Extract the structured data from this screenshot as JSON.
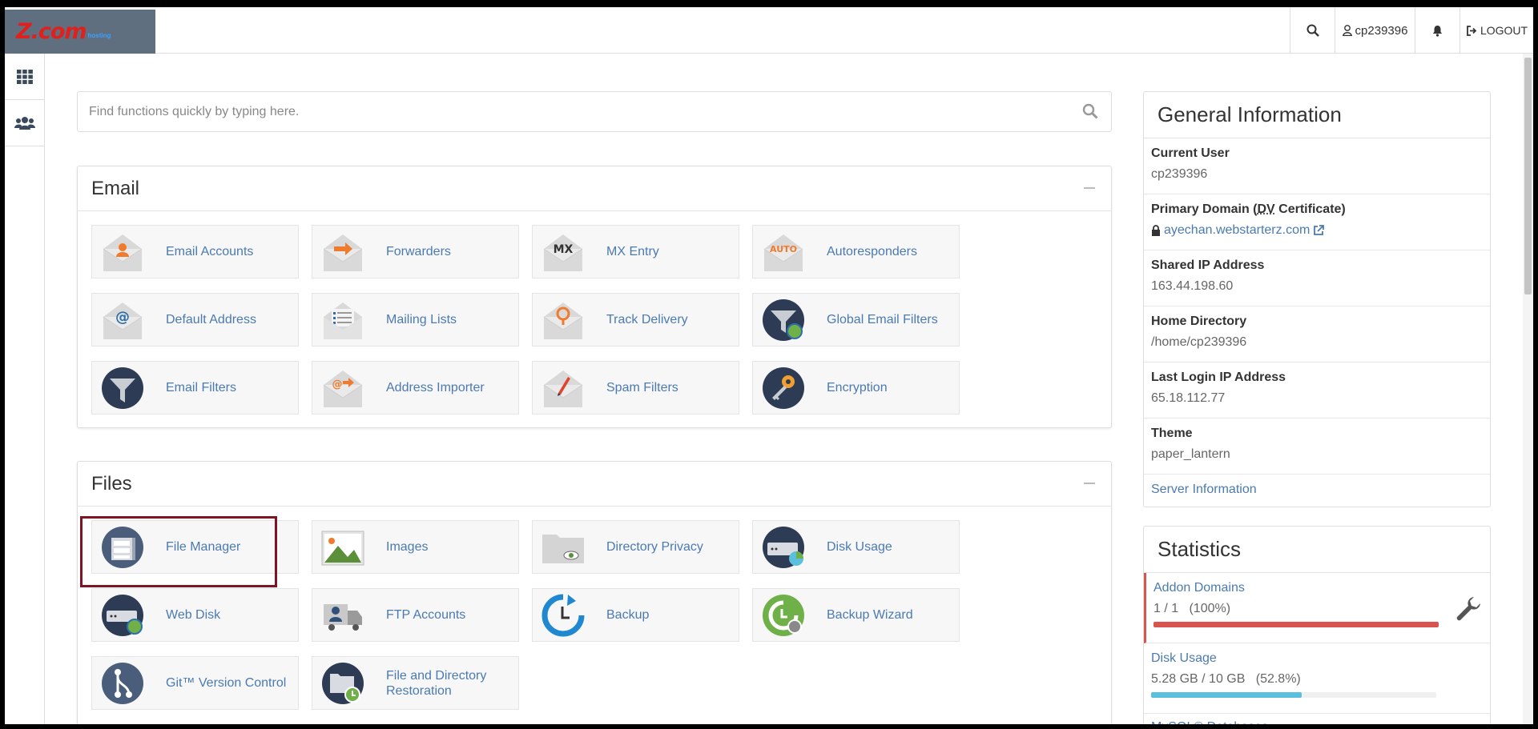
{
  "header": {
    "logo_text": "Z.com",
    "logo_sub": "hosting",
    "username": "cp239396",
    "logout_label": "LOGOUT"
  },
  "search": {
    "placeholder": "Find functions quickly by typing here."
  },
  "email_panel": {
    "title": "Email",
    "items": [
      {
        "label": "Email Accounts",
        "icon": "email-accounts-icon"
      },
      {
        "label": "Forwarders",
        "icon": "forwarders-icon"
      },
      {
        "label": "MX Entry",
        "icon": "mx-entry-icon"
      },
      {
        "label": "Autoresponders",
        "icon": "autoresponders-icon"
      },
      {
        "label": "Default Address",
        "icon": "default-address-icon"
      },
      {
        "label": "Mailing Lists",
        "icon": "mailing-lists-icon"
      },
      {
        "label": "Track Delivery",
        "icon": "track-delivery-icon"
      },
      {
        "label": "Global Email Filters",
        "icon": "global-email-filters-icon"
      },
      {
        "label": "Email Filters",
        "icon": "email-filters-icon"
      },
      {
        "label": "Address Importer",
        "icon": "address-importer-icon"
      },
      {
        "label": "Spam Filters",
        "icon": "spam-filters-icon"
      },
      {
        "label": "Encryption",
        "icon": "encryption-icon"
      }
    ],
    "mx_text": "MX",
    "auto_text": "AUTO"
  },
  "files_panel": {
    "title": "Files",
    "items": [
      {
        "label": "File Manager",
        "icon": "file-manager-icon"
      },
      {
        "label": "Images",
        "icon": "images-icon"
      },
      {
        "label": "Directory Privacy",
        "icon": "directory-privacy-icon"
      },
      {
        "label": "Disk Usage",
        "icon": "disk-usage-icon"
      },
      {
        "label": "Web Disk",
        "icon": "web-disk-icon"
      },
      {
        "label": "FTP Accounts",
        "icon": "ftp-accounts-icon"
      },
      {
        "label": "Backup",
        "icon": "backup-icon"
      },
      {
        "label": "Backup Wizard",
        "icon": "backup-wizard-icon"
      },
      {
        "label": "Git™ Version Control",
        "icon": "git-icon"
      },
      {
        "label": "File and Directory Restoration",
        "icon": "restoration-icon"
      }
    ]
  },
  "general_info": {
    "title": "General Information",
    "current_user_label": "Current User",
    "current_user": "cp239396",
    "primary_domain_label_a": "Primary Domain (",
    "primary_domain_label_dv": "DV",
    "primary_domain_label_b": " Certificate)",
    "primary_domain": "ayechan.webstarterz.com",
    "shared_ip_label": "Shared IP Address",
    "shared_ip": "163.44.198.60",
    "home_dir_label": "Home Directory",
    "home_dir": "/home/cp239396",
    "last_login_label": "Last Login IP Address",
    "last_login": "65.18.112.77",
    "theme_label": "Theme",
    "theme": "paper_lantern",
    "server_info_link": "Server Information"
  },
  "statistics": {
    "title": "Statistics",
    "addon_domains_label": "Addon Domains",
    "addon_domains_value": "1 / 1   (100%)",
    "addon_domains_fraction": 1.0,
    "disk_usage_label": "Disk Usage",
    "disk_usage_value": "5.28 GB / 10 GB   (52.8%)",
    "disk_usage_fraction": 0.528,
    "next_label": "MySQL® Databases"
  },
  "colors": {
    "link": "#4b7ab1",
    "alert_red": "#d9534f",
    "info_blue": "#5bc0de",
    "highlight": "#7d1424"
  }
}
